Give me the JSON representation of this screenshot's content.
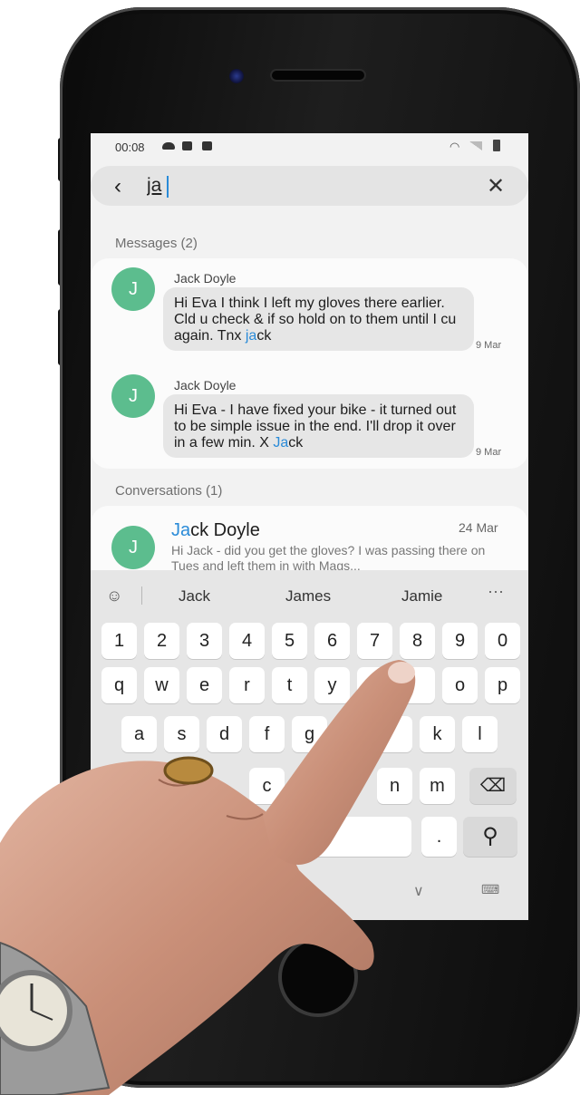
{
  "status_bar": {
    "time": "00:08"
  },
  "search": {
    "query": "ja"
  },
  "messages_section": {
    "label": "Messages (2)"
  },
  "messages": [
    {
      "sender": "Jack Doyle",
      "avatar_letter": "J",
      "text_before": "Hi Eva I think I left my gloves there earlier. Cld u check & if so hold on to them until I cu again. Tnx ",
      "highlight": "ja",
      "text_after": "ck",
      "date": "9 Mar"
    },
    {
      "sender": "Jack Doyle",
      "avatar_letter": "J",
      "text_before": "Hi Eva - I have fixed your bike - it turned out to be simple issue in the end. I'll drop it over in a few min. X ",
      "highlight": "Ja",
      "text_after": "ck",
      "date": "9 Mar"
    }
  ],
  "conversations_section": {
    "label": "Conversations (1)"
  },
  "conversation": {
    "avatar_letter": "J",
    "name_highlight": "Ja",
    "name_rest": "ck Doyle",
    "date": "24 Mar",
    "preview": "Hi Jack - did you get the gloves? I was passing there on Tues and left them in with Mags..."
  },
  "keyboard": {
    "suggestions": [
      "Jack",
      "James",
      "Jamie"
    ],
    "keys": {
      "1": "1",
      "2": "2",
      "3": "3",
      "4": "4",
      "5": "5",
      "6": "6",
      "7": "7",
      "8": "8",
      "9": "9",
      "0": "0",
      "q": "q",
      "w": "w",
      "e": "e",
      "r": "r",
      "t": "t",
      "y": "y",
      "o": "o",
      "p": "p",
      "a": "a",
      "s": "s",
      "d": "d",
      "f": "f",
      "g": "g",
      "k": "k",
      "l": "l",
      "c": "c",
      "n": "n",
      "m": "m",
      "period": "."
    }
  },
  "icons": {
    "back": "chevron-left",
    "clear": "close",
    "search": "magnifier",
    "backspace": "backspace",
    "hide_keyboard": "chevron-down",
    "keyboard_switch": "keyboard",
    "suggestion_mode": "emoji-swap",
    "suggestion_more": "more-horizontal"
  },
  "colors": {
    "accent": "#2a8bd8",
    "avatar": "#5cbd8e"
  }
}
